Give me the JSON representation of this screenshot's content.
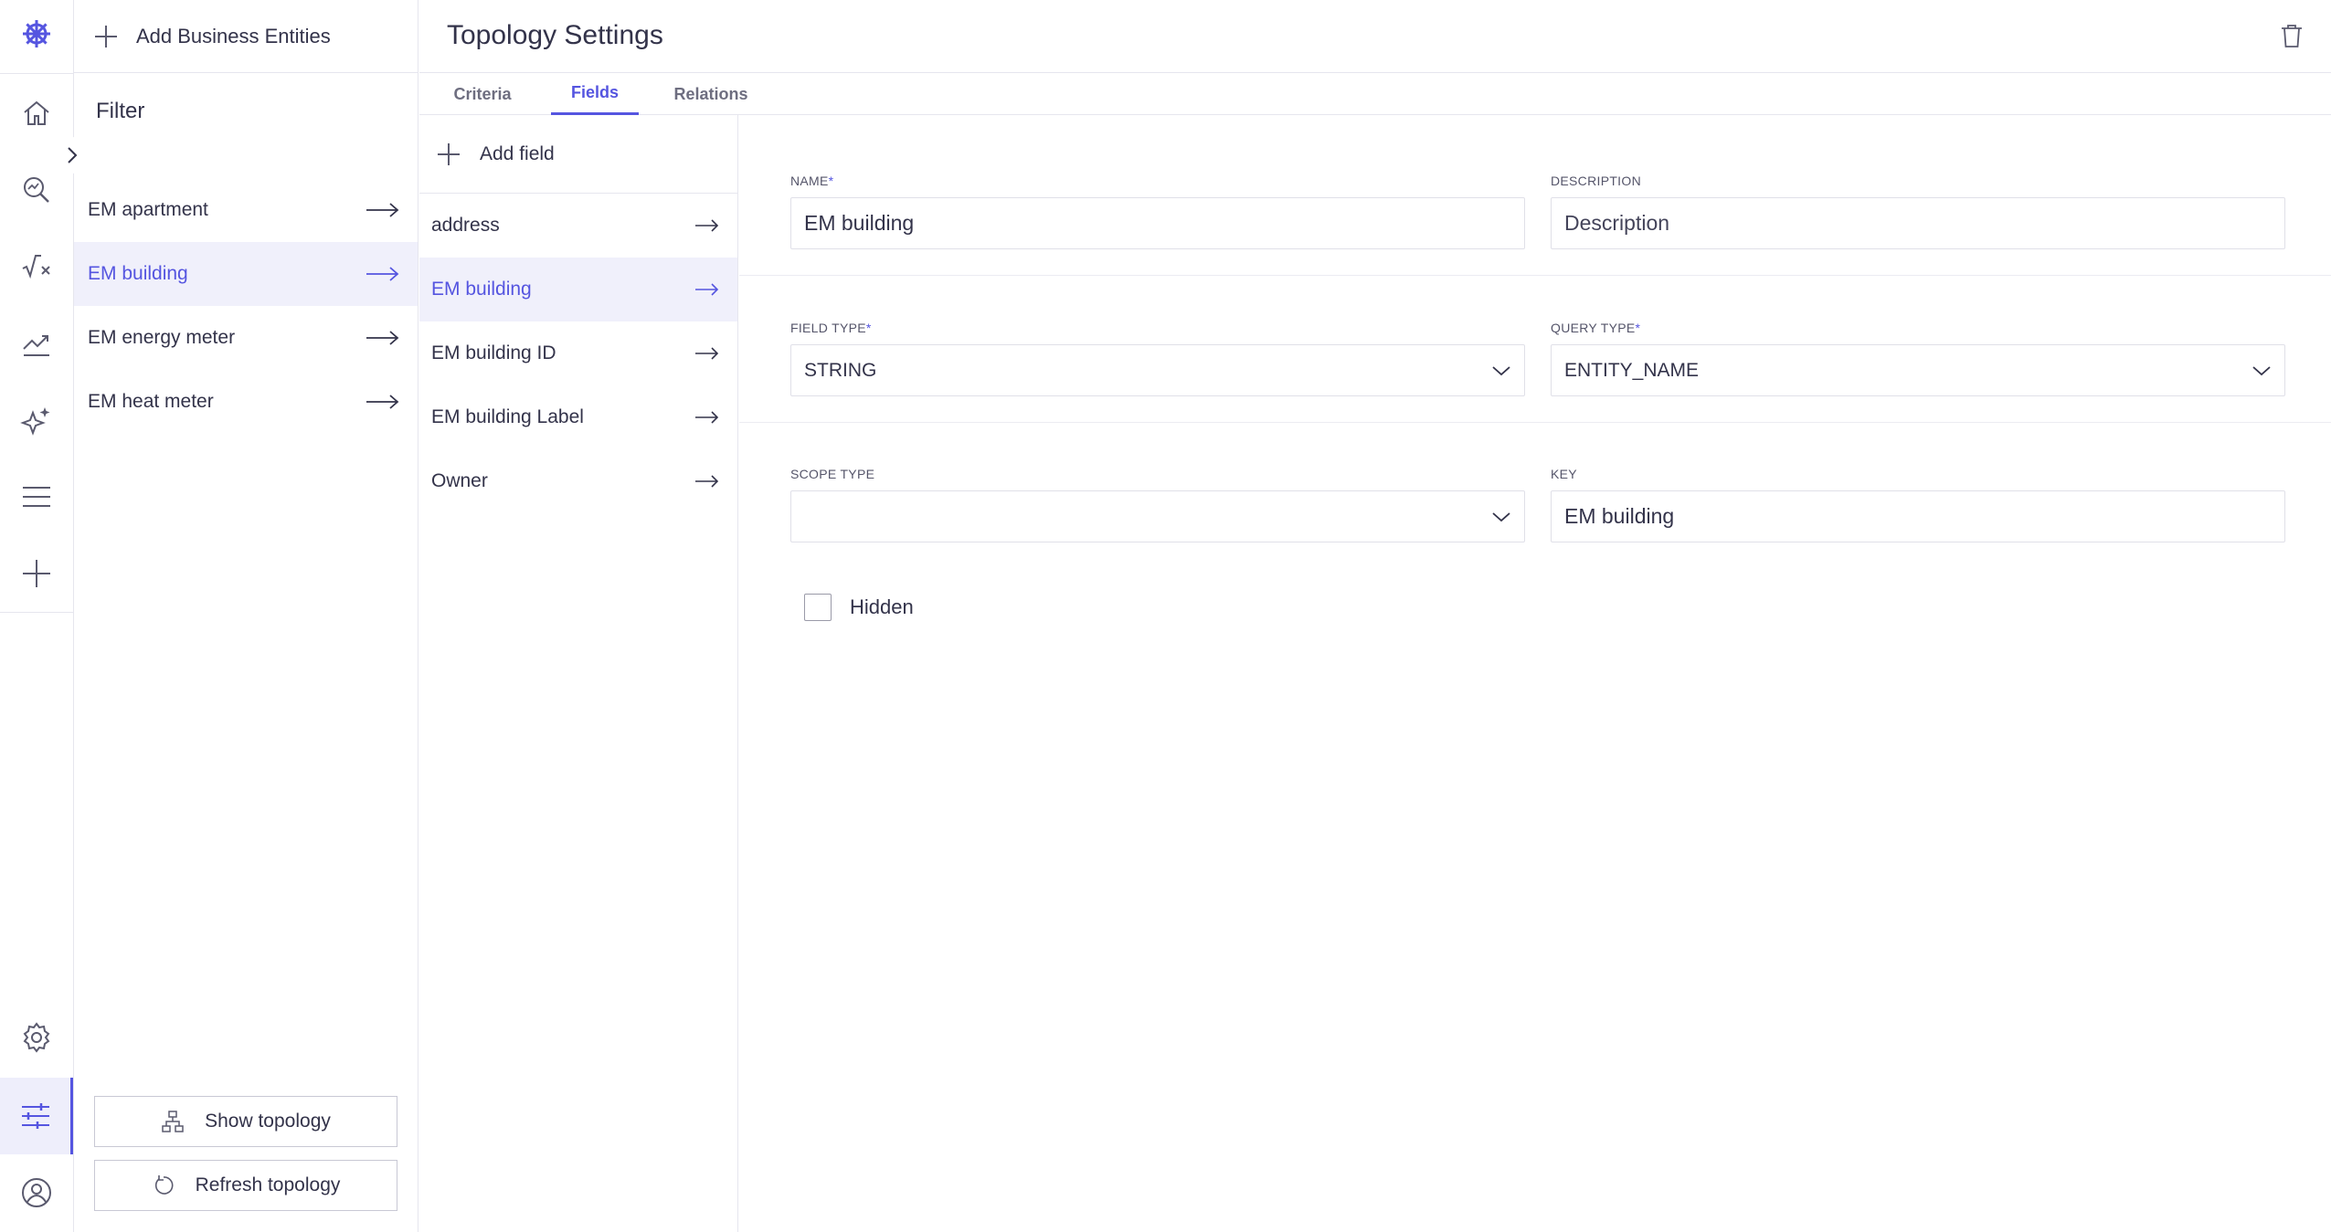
{
  "sidebar_rail": {
    "icons": [
      "logo-icon",
      "home-icon",
      "search-analytics-icon",
      "formula-icon",
      "trend-chart-icon",
      "sparkle-ai-icon",
      "menu-icon",
      "plus-icon",
      "gear-icon",
      "sliders-icon",
      "user-icon"
    ],
    "active": "sliders-icon",
    "accent": "#5555e0"
  },
  "entities_panel": {
    "add_label": "Add Business Entities",
    "filter_title": "Filter",
    "items": [
      {
        "label": "EM apartment",
        "active": false
      },
      {
        "label": "EM building",
        "active": true
      },
      {
        "label": "EM energy meter",
        "active": false
      },
      {
        "label": "EM heat meter",
        "active": false
      }
    ],
    "show_topology_label": "Show topology",
    "refresh_topology_label": "Refresh topology"
  },
  "header": {
    "title": "Topology Settings"
  },
  "tabs": [
    {
      "label": "Criteria",
      "active": false
    },
    {
      "label": "Fields",
      "active": true
    },
    {
      "label": "Relations",
      "active": false
    }
  ],
  "fields_list": {
    "add_label": "Add field",
    "items": [
      {
        "label": "address",
        "active": false
      },
      {
        "label": "EM building",
        "active": true
      },
      {
        "label": "EM building ID",
        "active": false
      },
      {
        "label": "EM building Label",
        "active": false
      },
      {
        "label": "Owner",
        "active": false
      }
    ]
  },
  "form": {
    "name": {
      "label": "NAME",
      "required": "*",
      "value": "EM building"
    },
    "description": {
      "label": "DESCRIPTION",
      "placeholder": "Description",
      "value": ""
    },
    "field_type": {
      "label": "FIELD TYPE",
      "required": "*",
      "value": "STRING"
    },
    "query_type": {
      "label": "QUERY TYPE",
      "required": "*",
      "value": "ENTITY_NAME"
    },
    "scope_type": {
      "label": "SCOPE TYPE",
      "value": ""
    },
    "key": {
      "label": "KEY",
      "value": "EM building"
    },
    "hidden": {
      "label": "Hidden",
      "checked": false
    }
  }
}
